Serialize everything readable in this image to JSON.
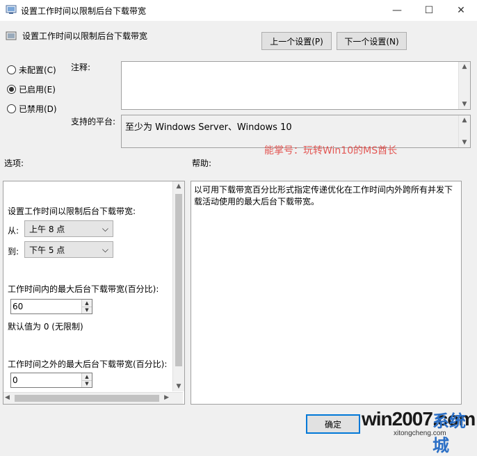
{
  "window": {
    "title": "设置工作时间以限制后台下载带宽",
    "minimize": "—",
    "maximize": "☐",
    "close": "✕"
  },
  "header": {
    "title": "设置工作时间以限制后台下载带宽",
    "prev_button": "上一个设置(P)",
    "next_button": "下一个设置(N)"
  },
  "state": {
    "options": [
      {
        "label": "未配置(C)",
        "selected": false
      },
      {
        "label": "已启用(E)",
        "selected": true
      },
      {
        "label": "已禁用(D)",
        "selected": false
      }
    ]
  },
  "comment": {
    "label": "注释:",
    "value": ""
  },
  "platform": {
    "label": "支持的平台:",
    "value": "至少为 Windows Server、Windows 10"
  },
  "watermark": "能掌号：玩转Win10的MS酋长",
  "sections": {
    "options_label": "选项:",
    "help_label": "帮助:"
  },
  "options_panel": {
    "heading": "设置工作时间以限制后台下载带宽:",
    "from_label": "从:",
    "from_value": "上午 8 点",
    "to_label": "到:",
    "to_value": "下午 5 点",
    "max_in_label": "工作时间内的最大后台下载带宽(百分比):",
    "max_in_value": "60",
    "default_note": "默认值为 0 (无限制)",
    "max_out_label": "工作时间之外的最大后台下载带宽(百分比):",
    "max_out_value": "0"
  },
  "help_text": "以可用下载带宽百分比形式指定传递优化在工作时间内外跨所有并发下载活动使用的最大后台下载带宽。",
  "footer": {
    "ok_button": "确定"
  },
  "brand": {
    "main": "win2007.com",
    "sub": "xitongcheng.com",
    "cn": "系统城"
  }
}
